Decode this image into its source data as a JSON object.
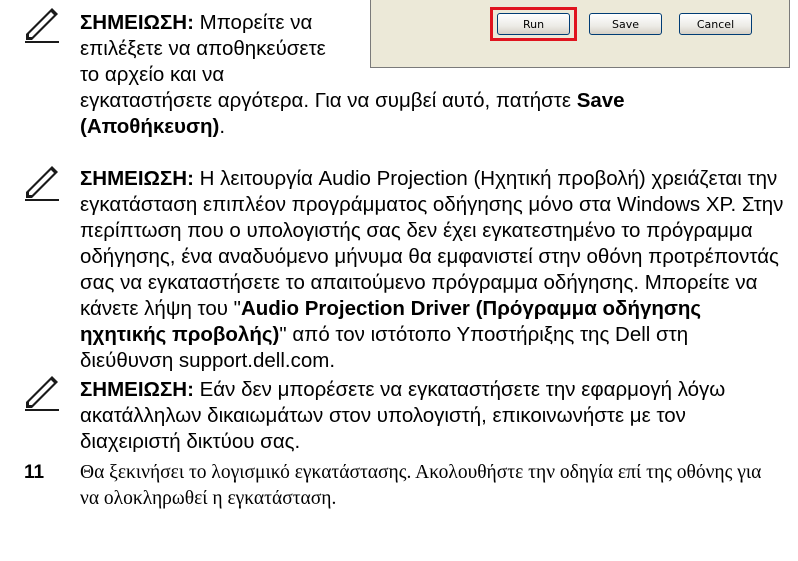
{
  "dialog": {
    "run_label": "Run",
    "save_label": "Save",
    "cancel_label": "Cancel"
  },
  "note1": {
    "label": "ΣΗΜΕΙΩΣΗ:",
    "text_a": " Μπορείτε να",
    "line2": "επιλέξετε να αποθηκεύσετε",
    "line3": "το αρχείο και να",
    "line4": "εγκαταστήσετε αργότερα. Για να συμβεί αυτό, πατήστε ",
    "save_bold": "Save",
    "save_gr": "(Αποθήκευση)",
    "end": "."
  },
  "note2": {
    "label": "ΣΗΜΕΙΩΣΗ:",
    "text_a": " Η λειτουργία Audio Projection (Ηχητική προβολή) χρειάζεται την εγκατάσταση επιπλέον προγράμματος οδήγησης μόνο στα Windows XP. Στην περίπτωση που ο υπολογιστής σας δεν έχει εγκατεστημένο το πρόγραμμα οδήγησης, ένα αναδυόμενο μήνυμα θα εμφανιστεί στην οθόνη προτρέποντάς σας να εγκαταστήσετε το απαιτούμενο πρόγραμμα οδήγησης. Μπορείτε να κάνετε λήψη του \"",
    "driver_bold": "Audio Projection Driver (Πρόγραμμα οδήγησης ηχητικής προβολής)",
    "text_b": "\" από τον ιστότοπο Υποστήριξης της Dell στη διεύθυνση support.dell.com."
  },
  "note3": {
    "label": "ΣΗΜΕΙΩΣΗ:",
    "text": " Εάν δεν μπορέσετε να εγκαταστήσετε την εφαρμογή λόγω ακατάλληλων δικαιωμάτων στον υπολογιστή, επικοινωνήστε με τον διαχειριστή δικτύου σας."
  },
  "step": {
    "number": "11",
    "text": "Θα ξεκινήσει το λογισμικό εγκατάστασης. Ακολουθήστε την οδηγία επί της οθόνης για να ολοκληρωθεί η εγκατάσταση."
  }
}
